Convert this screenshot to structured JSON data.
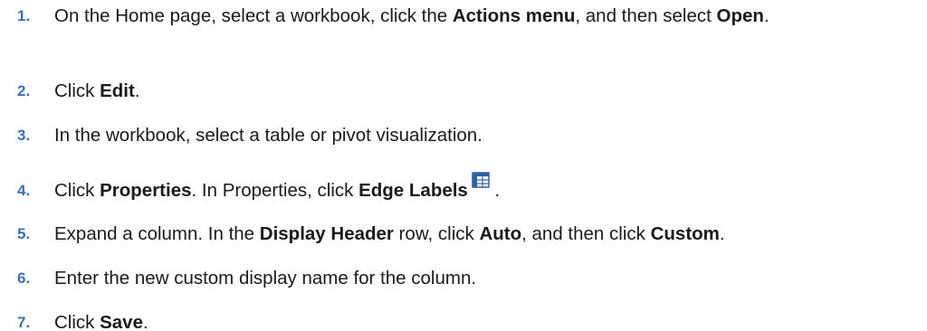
{
  "steps": [
    {
      "number": "1.",
      "parts": [
        "On the Home page, select a workbook, click the ",
        "Actions menu",
        ", and then select ",
        "Open",
        "."
      ]
    },
    {
      "number": "2.",
      "parts": [
        "Click ",
        "Edit",
        "."
      ]
    },
    {
      "number": "3.",
      "parts": [
        "In the workbook, select a table or pivot visualization."
      ]
    },
    {
      "number": "4.",
      "parts": [
        "Click ",
        "Properties",
        ". In Properties, click ",
        "Edge Labels",
        " ."
      ],
      "icon": "edge-labels-icon"
    },
    {
      "number": "5.",
      "parts": [
        "Expand a column. In the ",
        "Display Header",
        " row, click ",
        "Auto",
        ", and then click ",
        "Custom",
        "."
      ]
    },
    {
      "number": "6.",
      "parts": [
        "Enter the new custom display name for the column."
      ]
    },
    {
      "number": "7.",
      "parts": [
        "Click ",
        "Save",
        "."
      ]
    }
  ],
  "colors": {
    "step_number": "#3a6fb5",
    "text": "#1a1a1a",
    "icon": "#2f5fa8"
  }
}
